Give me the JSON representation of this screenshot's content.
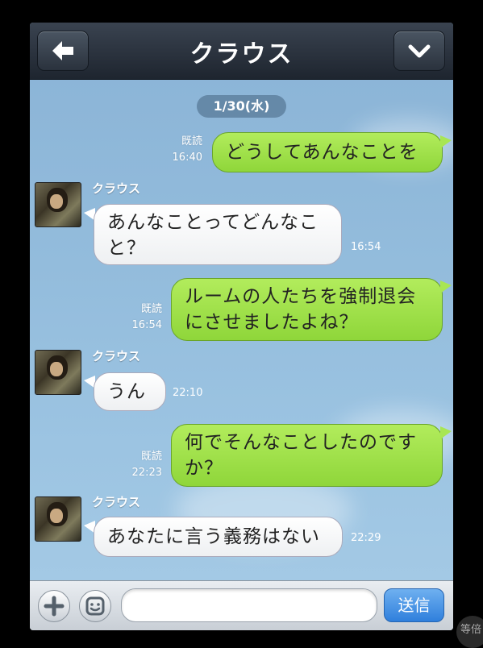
{
  "header": {
    "title": "クラウス",
    "back_icon": "arrow-left-icon",
    "menu_icon": "chevron-down-icon"
  },
  "date_label": "1/30(水)",
  "messages": [
    {
      "dir": "out",
      "text": "どうしてあんなことを",
      "read": "既読",
      "time": "16:40"
    },
    {
      "dir": "in",
      "sender": "クラウス",
      "line1": "あんなことってどんなこ",
      "line2": "と？",
      "time": "16:54"
    },
    {
      "dir": "out",
      "line1": "ルームの人たちを強制退会",
      "line2": "にさせましたよね？",
      "read": "既読",
      "time": "16:54"
    },
    {
      "dir": "in",
      "sender": "クラウス",
      "text": "うん",
      "time": "22:10"
    },
    {
      "dir": "out",
      "line1": "何でそんなことしたのです",
      "line2": "か？",
      "read": "既読",
      "time": "22:23"
    },
    {
      "dir": "in",
      "sender": "クラウス",
      "text": "あなたに言う義務はない",
      "time": "22:29"
    }
  ],
  "input": {
    "placeholder": "",
    "send_label": "送信",
    "plus_icon": "plus-icon",
    "emoji_icon": "smiley-icon"
  },
  "corner_badge": "等倍",
  "colors": {
    "outgoing_bubble": "#a8e653",
    "incoming_bubble": "#ffffff",
    "header": "#2a323d",
    "send_button": "#2f7fdc"
  }
}
